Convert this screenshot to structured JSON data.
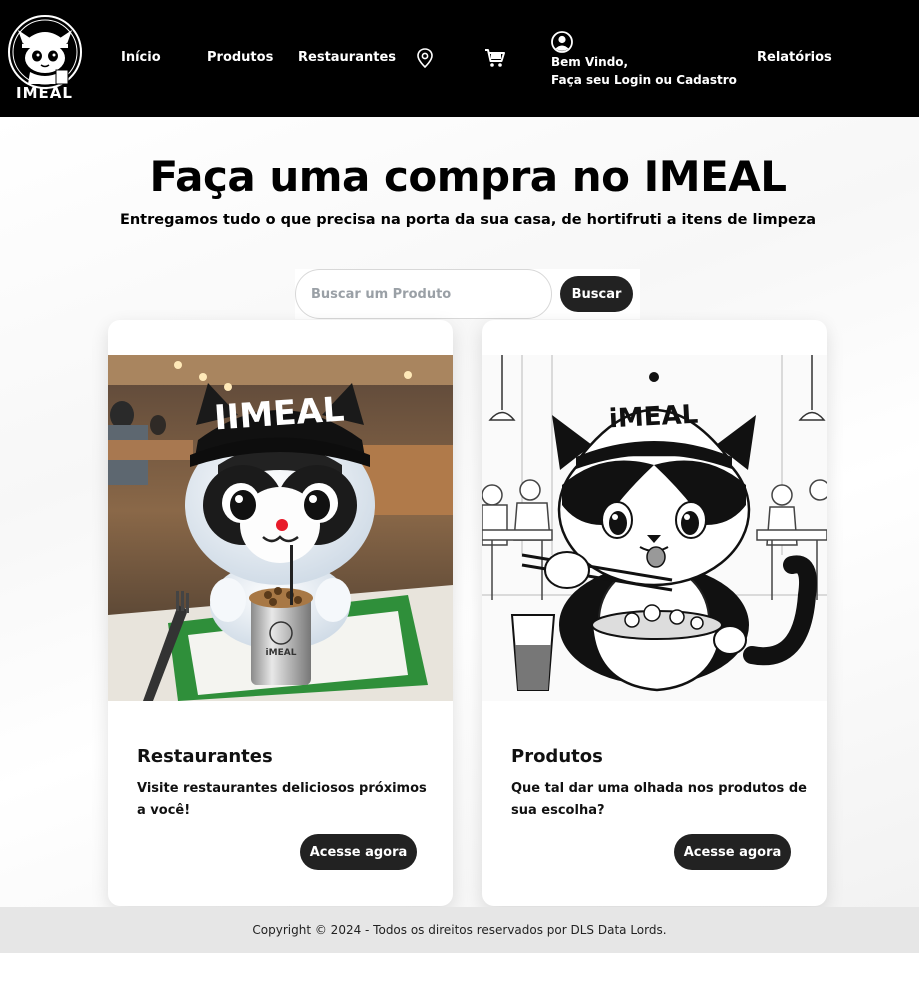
{
  "header": {
    "logo_text": "IMEAL",
    "nav": {
      "inicio": "Início",
      "produtos": "Produtos",
      "restaurantes": "Restaurantes",
      "relatorios": "Relatórios"
    },
    "icons": {
      "location": "location-pin-icon",
      "cart": "shopping-cart-icon",
      "user": "user-circle-icon"
    },
    "welcome_line1": "Bem Vindo,",
    "welcome_line2": "Faça seu Login ou Cadastro"
  },
  "hero": {
    "title": "Faça uma compra no IMEAL",
    "subtitle": "Entregamos tudo o que precisa na porta da sua casa, de hortifruti a itens de limpeza"
  },
  "search": {
    "placeholder": "Buscar um Produto",
    "value": "",
    "button_label": "Buscar"
  },
  "cards": [
    {
      "title": "Restaurantes",
      "text": "Visite restaurantes deliciosos próximos a você!",
      "button_label": "Acesse agora",
      "cap_text": "IIMEAL",
      "cup_text": "iMEAL"
    },
    {
      "title": "Produtos",
      "text": "Que tal dar uma olhada nos produtos de sua escolha?",
      "button_label": "Acesse agora",
      "cap_text": "iMEAL"
    }
  ],
  "footer": {
    "copyright": "Copyright © 2024 - Todos os direitos reservados por DLS Data Lords."
  },
  "colors": {
    "header_bg": "#000000",
    "button_bg": "#222222",
    "footer_bg": "#e6e6e6"
  }
}
